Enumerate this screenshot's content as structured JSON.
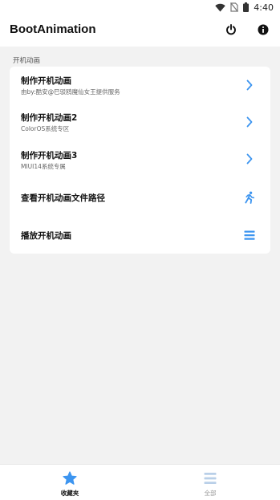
{
  "status_bar": {
    "time": "4:40"
  },
  "app_bar": {
    "title": "BootAnimation",
    "power_icon": "power-icon",
    "info_icon": "info-icon"
  },
  "section": {
    "header": "开机动画"
  },
  "rows": [
    {
      "title": "制作开机动画",
      "subtitle": "由by:酷安@巳驳鸥魔仙女王提供服务",
      "icon": "chevron-right-icon"
    },
    {
      "title": "制作开机动画2",
      "subtitle": "ColorOS系统专区",
      "icon": "chevron-right-icon"
    },
    {
      "title": "制作开机动画3",
      "subtitle": "MIUI14系统专属",
      "icon": "chevron-right-icon"
    },
    {
      "title": "查看开机动画文件路径",
      "subtitle": "",
      "icon": "running-person-icon"
    },
    {
      "title": "播放开机动画",
      "subtitle": "",
      "icon": "menu-icon"
    }
  ],
  "bottom_nav": [
    {
      "label": "收藏夹",
      "icon": "star-icon",
      "active": true
    },
    {
      "label": "全部",
      "icon": "list-icon",
      "active": false
    }
  ],
  "colors": {
    "accent": "#3d95f0",
    "inactive": "#b9cfe8",
    "background": "#f2f2f2",
    "card": "#ffffff"
  }
}
